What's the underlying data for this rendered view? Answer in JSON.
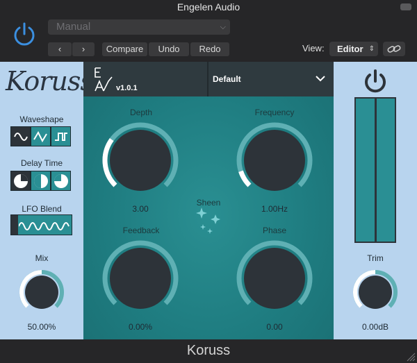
{
  "host": {
    "title": "Engelen Audio",
    "preset": "Manual",
    "nav_prev": "‹",
    "nav_next": "›",
    "compare": "Compare",
    "undo": "Undo",
    "redo": "Redo",
    "view_label": "View:",
    "view_value": "Editor",
    "icons": [
      "power-icon",
      "chevron-down-icon",
      "link-icon"
    ]
  },
  "plugin": {
    "logo": "Koruss",
    "version": "v1.0.1",
    "preset": "Default",
    "left": {
      "waveshape_label": "Waveshape",
      "waveshapes": [
        "sine",
        "triangle",
        "square"
      ],
      "waveshape_selected": "sine",
      "delay_time_label": "Delay Time",
      "delay_times": [
        "three-quarter",
        "half",
        "quarter"
      ],
      "delay_time_selected": "three-quarter",
      "lfo_blend_label": "LFO Blend",
      "mix_label": "Mix",
      "mix_value": "50.00%",
      "mix_fraction": 0.5
    },
    "center": {
      "depth_label": "Depth",
      "depth_value": "3.00",
      "depth_fraction": 0.3,
      "frequency_label": "Frequency",
      "frequency_value": "1.00Hz",
      "frequency_fraction": 0.1,
      "sheen_label": "Sheen",
      "feedback_label": "Feedback",
      "feedback_value": "0.00%",
      "feedback_fraction": 0,
      "phase_label": "Phase",
      "phase_value": "0.00",
      "phase_fraction": 0
    },
    "right": {
      "trim_label": "Trim",
      "trim_value": "0.00dB",
      "trim_fraction": 0.5
    }
  },
  "footer": {
    "title": "Koruss"
  },
  "colors": {
    "panel": "#b8d4ee",
    "teal": "#2a8f94",
    "dark": "#2d3339",
    "arc_track": "#5fb0b4",
    "arc_value": "#ffffff",
    "host_accent": "#3b8fe0"
  }
}
